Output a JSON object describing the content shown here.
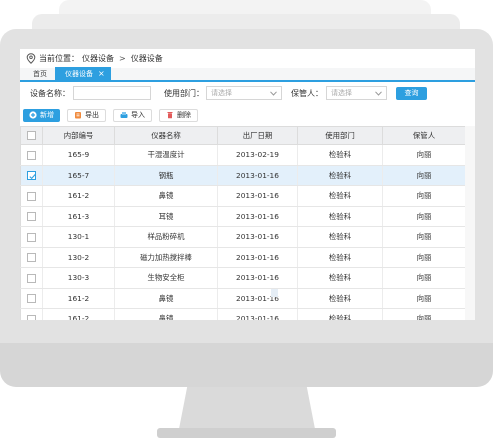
{
  "breadcrumb": {
    "icon": "location-pin-icon",
    "prefix": "当前位置：",
    "item1": "仪器设备",
    "sep": ">",
    "item2": "仪器设备"
  },
  "tabs": [
    {
      "label": "首页",
      "active": false
    },
    {
      "label": "仪器设备",
      "active": true,
      "close": "×"
    }
  ],
  "filter": {
    "device_name_label": "设备名称：",
    "device_name_value": "",
    "dept_label": "使用部门：",
    "dept_placeholder": "请选择",
    "keeper_label": "保管人：",
    "keeper_placeholder": "请选择",
    "query_label": "查询"
  },
  "toolbar": {
    "add_label": "新增",
    "export_label": "导出",
    "import_label": "导入",
    "delete_label": "删除"
  },
  "table": {
    "headers": [
      "内部编号",
      "仪器名称",
      "出厂日期",
      "使用部门",
      "保管人"
    ],
    "rows": [
      {
        "checked": false,
        "code": "165-9",
        "name": "干湿温度计",
        "date": "2013-02-19",
        "dept": "检验科",
        "keeper": "向丽"
      },
      {
        "checked": true,
        "code": "165-7",
        "name": "钢瓶",
        "date": "2013-01-16",
        "dept": "检验科",
        "keeper": "向丽"
      },
      {
        "checked": false,
        "code": "161-2",
        "name": "鼻镜",
        "date": "2013-01-16",
        "dept": "检验科",
        "keeper": "向丽"
      },
      {
        "checked": false,
        "code": "161-3",
        "name": "耳镜",
        "date": "2013-01-16",
        "dept": "检验科",
        "keeper": "向丽"
      },
      {
        "checked": false,
        "code": "130-1",
        "name": "样品粉碎机",
        "date": "2013-01-16",
        "dept": "检验科",
        "keeper": "向丽"
      },
      {
        "checked": false,
        "code": "130-2",
        "name": "磁力加热搅拌棒",
        "date": "2013-01-16",
        "dept": "检验科",
        "keeper": "向丽"
      },
      {
        "checked": false,
        "code": "130-3",
        "name": "生物安全柜",
        "date": "2013-01-16",
        "dept": "检验科",
        "keeper": "向丽"
      },
      {
        "checked": false,
        "code": "161-2",
        "name": "鼻镜",
        "date": "2013-01-16",
        "dept": "检验科",
        "keeper": "向丽"
      },
      {
        "checked": false,
        "code": "161-2",
        "name": "鼻镜",
        "date": "2013-01-16",
        "dept": "检验科",
        "keeper": "向丽"
      }
    ]
  },
  "colors": {
    "accent": "#2d9fe0",
    "selected_row": "#e3f0fb",
    "header_bg": "#eeeff1",
    "monitor": "#e2e2e2"
  }
}
